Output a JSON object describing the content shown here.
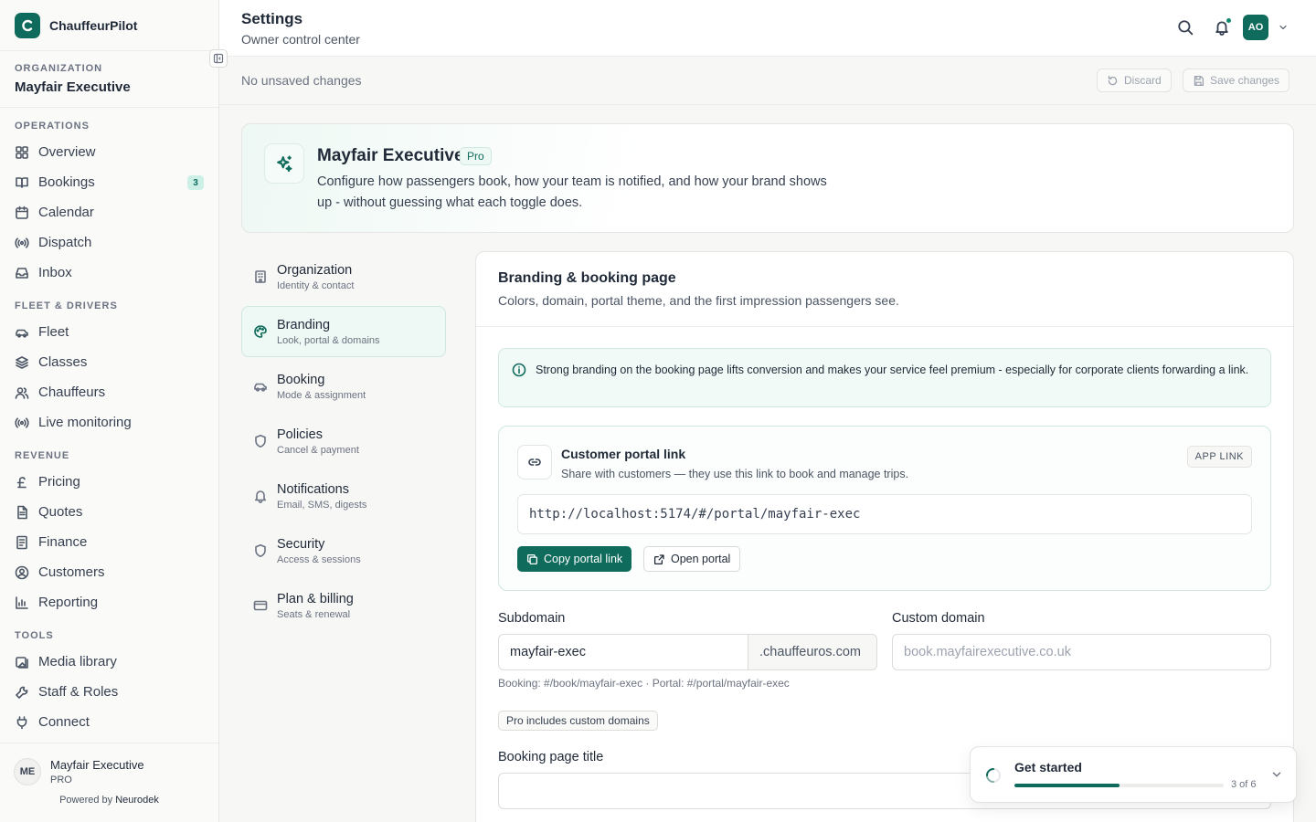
{
  "app": {
    "name": "ChauffeurPilot"
  },
  "sidebar": {
    "org_label": "ORGANIZATION",
    "org_name": "Mayfair Executive",
    "groups": [
      {
        "label": "OPERATIONS",
        "items": [
          {
            "label": "Overview",
            "icon": "grid-icon"
          },
          {
            "label": "Bookings",
            "icon": "book-icon",
            "badge": "3"
          },
          {
            "label": "Calendar",
            "icon": "calendar-icon"
          },
          {
            "label": "Dispatch",
            "icon": "broadcast-icon"
          },
          {
            "label": "Inbox",
            "icon": "inbox-icon"
          }
        ]
      },
      {
        "label": "FLEET & DRIVERS",
        "items": [
          {
            "label": "Fleet",
            "icon": "car-icon"
          },
          {
            "label": "Classes",
            "icon": "layers-icon"
          },
          {
            "label": "Chauffeurs",
            "icon": "users-icon"
          },
          {
            "label": "Live monitoring",
            "icon": "broadcast-icon"
          }
        ]
      },
      {
        "label": "REVENUE",
        "items": [
          {
            "label": "Pricing",
            "icon": "pound-icon"
          },
          {
            "label": "Quotes",
            "icon": "file-icon"
          },
          {
            "label": "Finance",
            "icon": "receipt-icon"
          },
          {
            "label": "Customers",
            "icon": "user-circle-icon"
          },
          {
            "label": "Reporting",
            "icon": "bar-chart-icon"
          }
        ]
      },
      {
        "label": "TOOLS",
        "items": [
          {
            "label": "Media library",
            "icon": "image-icon"
          },
          {
            "label": "Staff & Roles",
            "icon": "wrench-icon"
          },
          {
            "label": "Connect",
            "icon": "plug-icon"
          }
        ]
      }
    ],
    "account": {
      "initials": "ME",
      "name": "Mayfair Executive",
      "plan": "PRO"
    },
    "powered_prefix": "Powered by",
    "powered_brand": "Neurodek"
  },
  "header": {
    "title": "Settings",
    "subtitle": "Owner control center",
    "avatar_initials": "AO"
  },
  "savebar": {
    "status": "No unsaved changes",
    "discard_label": "Discard",
    "save_label": "Save changes"
  },
  "hero": {
    "title": "Mayfair Executive",
    "badge": "Pro",
    "description": "Configure how passengers book, how your team is notified, and how your brand shows up - without guessing what each toggle does."
  },
  "subnav": [
    {
      "title": "Organization",
      "desc": "Identity & contact",
      "icon": "building-icon"
    },
    {
      "title": "Branding",
      "desc": "Look, portal & domains",
      "icon": "palette-icon",
      "active": true
    },
    {
      "title": "Booking",
      "desc": "Mode & assignment",
      "icon": "car-icon"
    },
    {
      "title": "Policies",
      "desc": "Cancel & payment",
      "icon": "shield-icon"
    },
    {
      "title": "Notifications",
      "desc": "Email, SMS, digests",
      "icon": "bell-icon"
    },
    {
      "title": "Security",
      "desc": "Access & sessions",
      "icon": "shield-icon"
    },
    {
      "title": "Plan & billing",
      "desc": "Seats & renewal",
      "icon": "credit-card-icon"
    }
  ],
  "panel": {
    "title": "Branding & booking page",
    "subtitle": "Colors, domain, portal theme, and the first impression passengers see.",
    "info": "Strong branding on the booking page lifts conversion and makes your service feel premium - especially for corporate clients forwarding a link.",
    "portal": {
      "title": "Customer portal link",
      "subtitle": "Share with customers — they use this link to book and manage trips.",
      "badge": "APP LINK",
      "url": "http://localhost:5174/#/portal/mayfair-exec",
      "copy_label": "Copy portal link",
      "open_label": "Open portal"
    },
    "subdomain": {
      "label": "Subdomain",
      "value": "mayfair-exec",
      "suffix": ".chauffeuros.com"
    },
    "custom_domain": {
      "label": "Custom domain",
      "placeholder": "book.mayfairexecutive.co.uk"
    },
    "hint": "Booking: #/book/mayfair-exec · Portal: #/portal/mayfair-exec",
    "pro_pill": "Pro includes custom domains",
    "booking_title": {
      "label": "Booking page title",
      "value": ""
    }
  },
  "get_started": {
    "title": "Get started",
    "progress": 0.5,
    "count": "3 of 6"
  },
  "colors": {
    "accent": "#0f6b5c",
    "accent_light": "#eef8f4"
  }
}
